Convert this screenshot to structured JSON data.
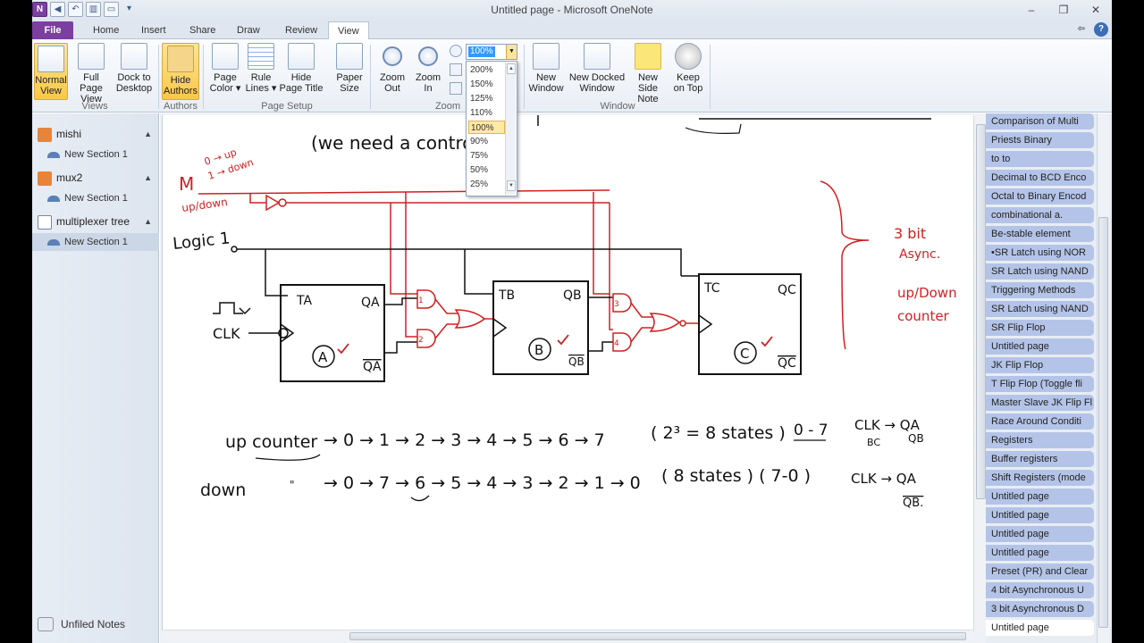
{
  "window": {
    "title": "Untitled page - Microsoft OneNote"
  },
  "ribbon_tabs": [
    "File",
    "Home",
    "Insert",
    "Share",
    "Draw",
    "Review",
    "View"
  ],
  "active_tab": "View",
  "ribbon": {
    "views": {
      "label": "Views",
      "normal_view": "Normal\nView",
      "full_page_view": "Full Page\nView",
      "dock_to_desktop": "Dock to\nDesktop"
    },
    "authors": {
      "label": "Authors",
      "hide_authors": "Hide\nAuthors"
    },
    "page_setup": {
      "label": "Page Setup",
      "page_color": "Page\nColor ▾",
      "rule_lines": "Rule\nLines ▾",
      "hide_page_title": "Hide\nPage Title",
      "paper_size": "Paper\nSize"
    },
    "zoom": {
      "label": "Zoom",
      "zoom_out": "Zoom\nOut",
      "zoom_in": "Zoom\nIn",
      "value": "100%",
      "options": [
        "200%",
        "150%",
        "125%",
        "110%",
        "100%",
        "90%",
        "75%",
        "50%",
        "25%"
      ],
      "selected": "100%"
    },
    "window_group": {
      "label": "Window",
      "new_window": "New\nWindow",
      "new_docked_window": "New Docked\nWindow",
      "new_side_note": "New Side\nNote",
      "keep_on_top": "Keep\non Top"
    }
  },
  "notebooks": [
    {
      "name": "mishi",
      "section": "New Section 1",
      "color": "#e8843a"
    },
    {
      "name": "mux2",
      "section": "New Section 1",
      "color": "#e8843a"
    },
    {
      "name": "multiplexer tree",
      "section": "New Section 1",
      "color": "#cfd6df"
    }
  ],
  "unfiled_notes": "Unfiled Notes",
  "pages": [
    "Comparison of Multi",
    "Priests Binary",
    "to to",
    "Decimal to BCD Enco",
    "Octal to Binary Encod",
    "combinational a.",
    "Be-stable element",
    "•SR Latch using NOR",
    "SR Latch using NAND",
    "Triggering Methods",
    "SR Latch using NAND",
    "SR Flip Flop",
    "Untitled page",
    "JK Flip Flop",
    "T Flip Flop (Toggle fli",
    "Master Slave JK Flip Fl",
    "Race Around Conditi",
    "Registers",
    "Buffer registers",
    "Shift Registers (mode",
    "Untitled page",
    "Untitled page",
    "Untitled page",
    "Untitled page",
    "Preset (PR) and Clear",
    "4 bit Asynchronous U",
    "3 bit Asynchronous D",
    "Untitled page"
  ],
  "current_page": "Untitled page",
  "ink": {
    "top_note": "(we need a     control Pin)",
    "mode_label": "M",
    "mode_up": "0 → up",
    "mode_down": "1 → down",
    "updown": "up/down",
    "logic1": "Logic 1",
    "clk": "CLK",
    "ff_a": {
      "t": "TA",
      "q": "QA",
      "qbar": "QA",
      "name": "A"
    },
    "ff_b": {
      "t": "TB",
      "q": "QB",
      "qbar": "QB",
      "name": "B"
    },
    "ff_c": {
      "t": "TC",
      "q": "QC",
      "qbar": "QC",
      "name": "C"
    },
    "gate1": "1",
    "gate2": "2",
    "gate3": "3",
    "gate4": "4",
    "side_note": [
      "3 bit",
      "Async.",
      "up/Down",
      "counter"
    ],
    "up_label": "up counter",
    "up_seq": "→ 0 → 1 → 2 → 3 → 4 → 5 → 6 → 7",
    "up_states": "( 2³ = 8 states )",
    "up_range": "0 - 7",
    "up_clk": "CLK → QA",
    "up_clk2": "QB",
    "up_clk_sub": "BC",
    "down_label": "down",
    "down_ditto": "\"",
    "down_seq": "→ 0 → 7 → 6 → 5 → 4 → 3 → 2 → 1 → 0",
    "down_states": "( 8 states ) ( 7-0 )",
    "down_clk": "CLK → QA",
    "down_clk2": "QB."
  }
}
